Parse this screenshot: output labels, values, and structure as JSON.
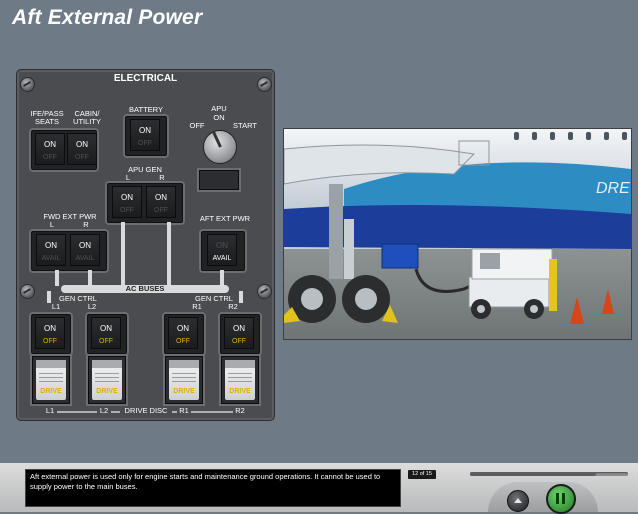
{
  "page": {
    "title": "Aft External Power"
  },
  "panel": {
    "header": "ELECTRICAL",
    "ife": {
      "label": "IFE/PASS\nSEATS",
      "top": "ON",
      "bottom": "OFF"
    },
    "cabin": {
      "label": "CABIN/\nUTILITY",
      "top": "ON",
      "bottom": "OFF"
    },
    "battery": {
      "label": "BATTERY",
      "top": "ON",
      "bottom": "OFF"
    },
    "apu": {
      "label": "APU",
      "on": "ON",
      "off": "OFF",
      "start": "START"
    },
    "apu_gen": {
      "label": "APU GEN",
      "l": "L",
      "r": "R",
      "l_top": "ON",
      "l_bottom": "OFF",
      "r_top": "ON",
      "r_bottom": "OFF"
    },
    "fwd_ext": {
      "label": "FWD EXT PWR",
      "l": "L",
      "r": "R",
      "l_top": "ON",
      "l_bottom": "AVAIL",
      "r_top": "ON",
      "r_bottom": "AVAIL"
    },
    "aft_ext": {
      "label": "AFT EXT PWR",
      "top": "ON",
      "bottom": "AVAIL"
    },
    "ac_buses": "AC BUSES",
    "gen_ctrl_left": {
      "label": "GEN CTRL",
      "a": "L1",
      "b": "L2"
    },
    "gen_ctrl_right": {
      "label": "GEN CTRL",
      "a": "R1",
      "b": "R2"
    },
    "gen_switches": [
      {
        "top": "ON",
        "bottom": "OFF"
      },
      {
        "top": "ON",
        "bottom": "OFF"
      },
      {
        "top": "ON",
        "bottom": "OFF"
      },
      {
        "top": "ON",
        "bottom": "OFF"
      }
    ],
    "drive_label": "DRIVE",
    "drive_disc": {
      "l1": "L1",
      "l2": "L2",
      "label": "DRIVE DISC",
      "r1": "R1",
      "r2": "R2"
    }
  },
  "photo": {
    "fuselage_text": "DRE"
  },
  "footer": {
    "caption": "Aft external power is used only for engine starts and maintenance ground operations. It cannot be used to supply power to the main buses.",
    "page_counter": "12 of 15",
    "progress": 0.8
  },
  "colors": {
    "lit": "#e0b000",
    "background": "#6e7b87"
  }
}
